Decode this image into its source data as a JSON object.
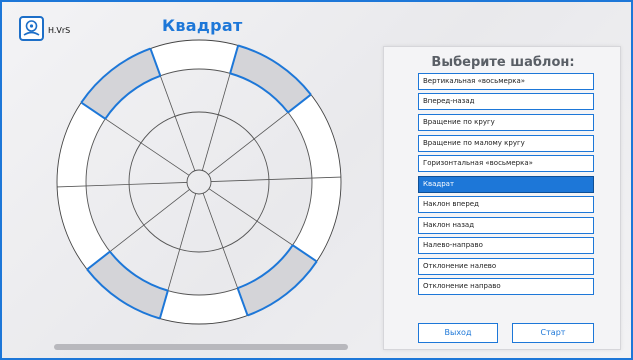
{
  "app": {
    "logo_text": "H.VrS",
    "title": "Квадрат"
  },
  "colors": {
    "accent": "#1d77d8",
    "segment_fill": "#d4d4d8"
  },
  "panel": {
    "title": "Выберите шаблон:",
    "templates": [
      "Вертикальная «восьмерка»",
      "Вперед-назад",
      "Вращение по кругу",
      "Вращение по малому кругу",
      "Горизонтальная «восьмерка»",
      "Квадрат",
      "Наклон вперед",
      "Наклон назад",
      "Налево-направо",
      "Отклонение налево",
      "Отклонение направо"
    ],
    "selected_index": 5,
    "exit_label": "Выход",
    "start_label": "Старт"
  }
}
